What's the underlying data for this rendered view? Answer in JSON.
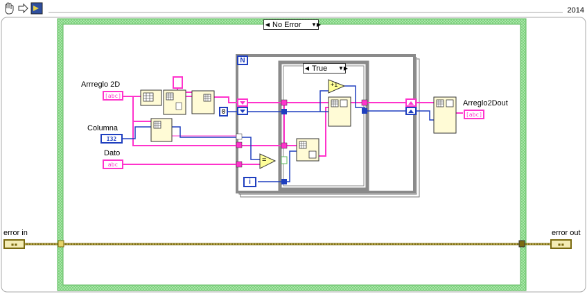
{
  "toolbar": {
    "hand_icon": "hand-icon",
    "arrow_icon": "run-arrow-icon",
    "vi_icon": "vi-icon",
    "version": "2014"
  },
  "case_structure_outer": {
    "selector": "No Error"
  },
  "case_structure_inner": {
    "selector": "True"
  },
  "for_loop": {
    "count_terminal": "N",
    "iteration_terminal": "i"
  },
  "controls": {
    "arreglo2d": {
      "label": "Arrreglo 2D",
      "type": "abc"
    },
    "columna": {
      "label": "Columna",
      "type": "I32"
    },
    "dato": {
      "label": "Dato",
      "type": "abc"
    },
    "error_in": {
      "label": "error in"
    }
  },
  "indicators": {
    "arreglo2dout": {
      "label": "Arreglo2Dout",
      "type": "abc"
    },
    "error_out": {
      "label": "error out"
    }
  },
  "constants": {
    "zero": "0"
  },
  "functions": {
    "equal": "=",
    "increment": "+1"
  },
  "colors": {
    "string_wire": "#ff33cc",
    "int_wire": "#1f3fbf",
    "error_wire": "#8a7a1a",
    "outer_case_border": "#5cb85c",
    "structure_gray": "#8a8a8a"
  }
}
